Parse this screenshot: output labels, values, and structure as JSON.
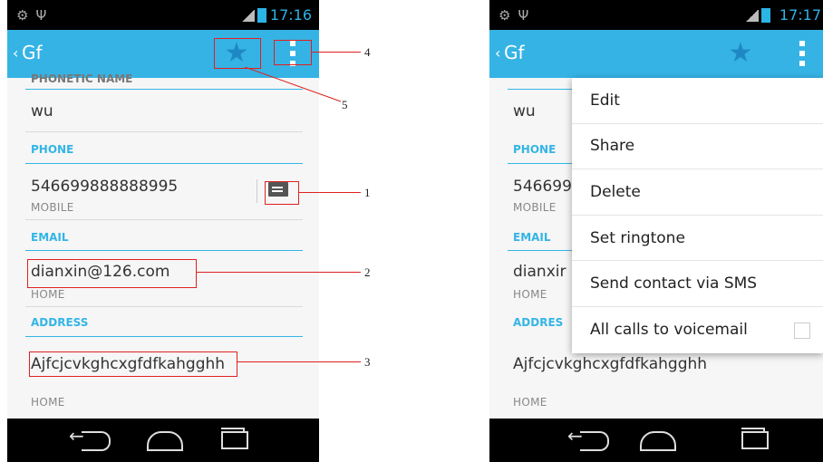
{
  "status": {
    "time_left": "17:16",
    "time_right": "17:17"
  },
  "contact": {
    "name": "Gf",
    "cut_header": "PHONETIC NAME",
    "phonetic": "wu",
    "phone_header": "PHONE",
    "phone": "546699888888995",
    "phone_type": "MOBILE",
    "email_header": "EMAIL",
    "email": "dianxin@126.com",
    "email_type": "HOME",
    "address_header": "ADDRESS",
    "address": "Ajfcjcvkghcxgfdfkahgghh",
    "address_type": "HOME"
  },
  "right_partial": {
    "phone": "546699",
    "phone_type": "MOBILE",
    "email": "dianxir",
    "email_type": "HOME",
    "address_header": "ADDRES",
    "phonetic": "wu",
    "phone_header": "PHONE",
    "email_header": "EMAIL"
  },
  "menu": {
    "items": [
      "Edit",
      "Share",
      "Delete",
      "Set ringtone",
      "Send contact via SMS",
      "All calls to voicemail"
    ],
    "voicemail_checked": false
  },
  "annotations": [
    "1",
    "2",
    "3",
    "4",
    "5"
  ],
  "icons": {
    "star": "star-icon",
    "overflow": "overflow-menu-icon",
    "sms": "message-icon",
    "back": "back-icon",
    "home": "home-icon",
    "recents": "recent-apps-icon"
  },
  "colors": {
    "accent": "#35b3e5",
    "annotation": "#e02020"
  }
}
